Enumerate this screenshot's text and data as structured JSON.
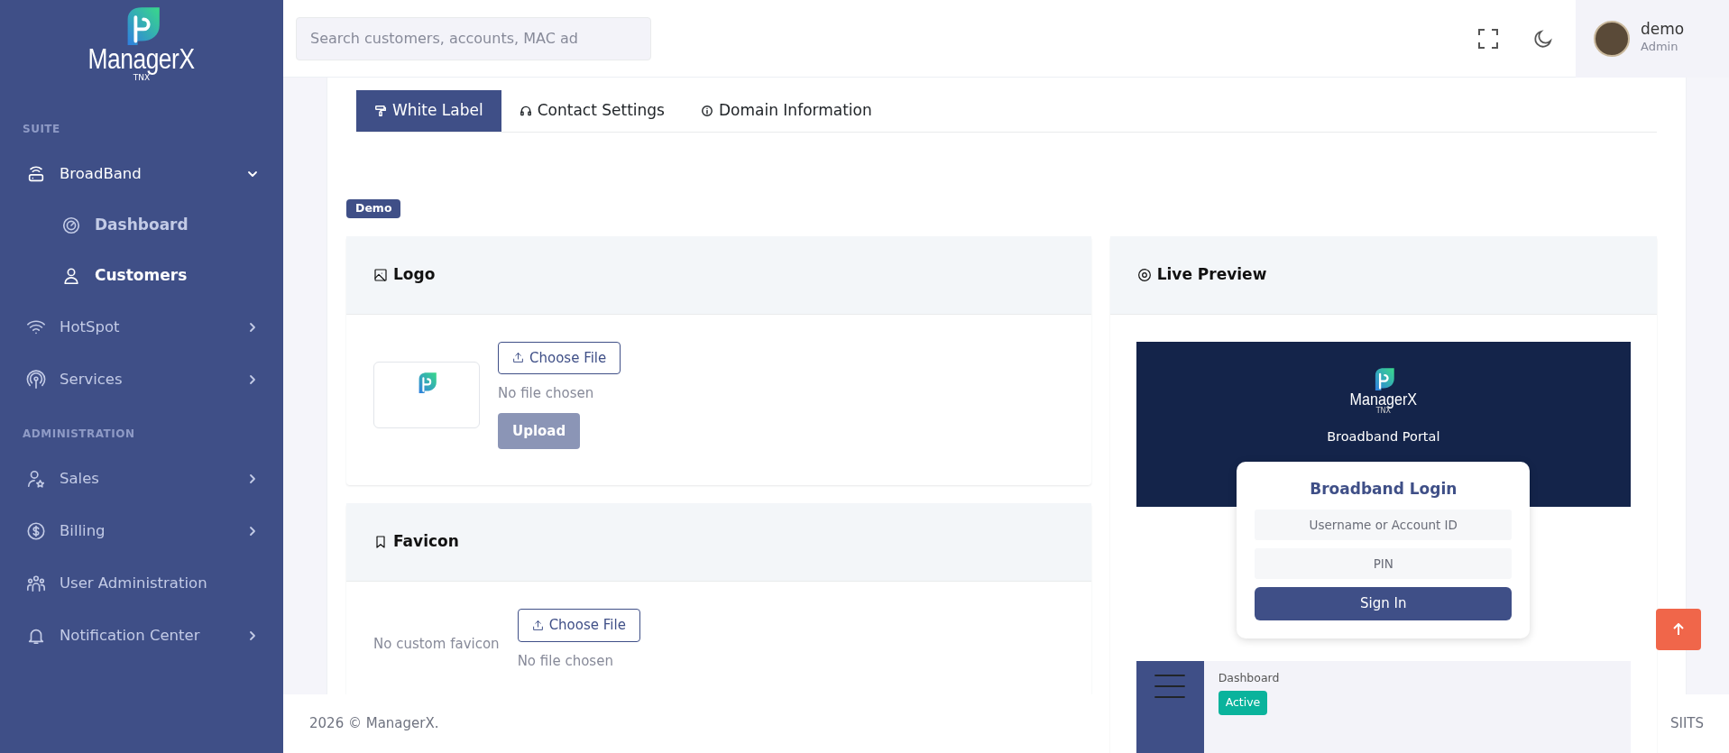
{
  "sidebar": {
    "brand": "ManagerX",
    "brand_tagline": "TNX",
    "sections": [
      {
        "title": "SUITE",
        "items": [
          {
            "label": "BroadBand",
            "expandable": true,
            "expanded": true,
            "children": [
              {
                "label": "Dashboard",
                "selected": false
              },
              {
                "label": "Customers",
                "selected": true
              }
            ]
          },
          {
            "label": "HotSpot",
            "expandable": true,
            "expanded": false
          },
          {
            "label": "Services",
            "expandable": true,
            "expanded": false
          }
        ]
      },
      {
        "title": "ADMINISTRATION",
        "items": [
          {
            "label": "Sales",
            "expandable": true,
            "expanded": false
          },
          {
            "label": "Billing",
            "expandable": true,
            "expanded": false
          },
          {
            "label": "User Administration",
            "expandable": false,
            "expanded": false
          },
          {
            "label": "Notification Center",
            "expandable": true,
            "expanded": false
          }
        ]
      }
    ]
  },
  "header": {
    "search": {
      "placeholder": "Search customers, accounts, MAC ad"
    },
    "user": {
      "name": "demo",
      "role": "Admin"
    }
  },
  "tabs": [
    {
      "label": "White Label",
      "selected": true
    },
    {
      "label": "Contact Settings",
      "selected": false
    },
    {
      "label": "Domain Information",
      "selected": false
    }
  ],
  "badge": "Demo",
  "logo_card": {
    "title": "Logo",
    "choose_button": "Choose File",
    "file_status": "No file chosen",
    "upload_button": "Upload",
    "upload_disabled": true
  },
  "favicon_card": {
    "title": "Favicon",
    "preview_text": "No custom favicon",
    "choose_button": "Choose File",
    "file_status": "No file chosen"
  },
  "preview_card": {
    "title": "Live Preview",
    "brand": "ManagerX",
    "brand_tagline": "TNX",
    "portal_title": "Broadband Portal",
    "login_title": "Broadband Login",
    "username_placeholder": "Username or Account ID",
    "pin_placeholder": "PIN",
    "sign_in_button": "Sign In",
    "dashboard_label": "Dashboard",
    "status": "Active"
  },
  "footer": {
    "copyright": "2026 © ManagerX.",
    "credit": "SIITS"
  }
}
